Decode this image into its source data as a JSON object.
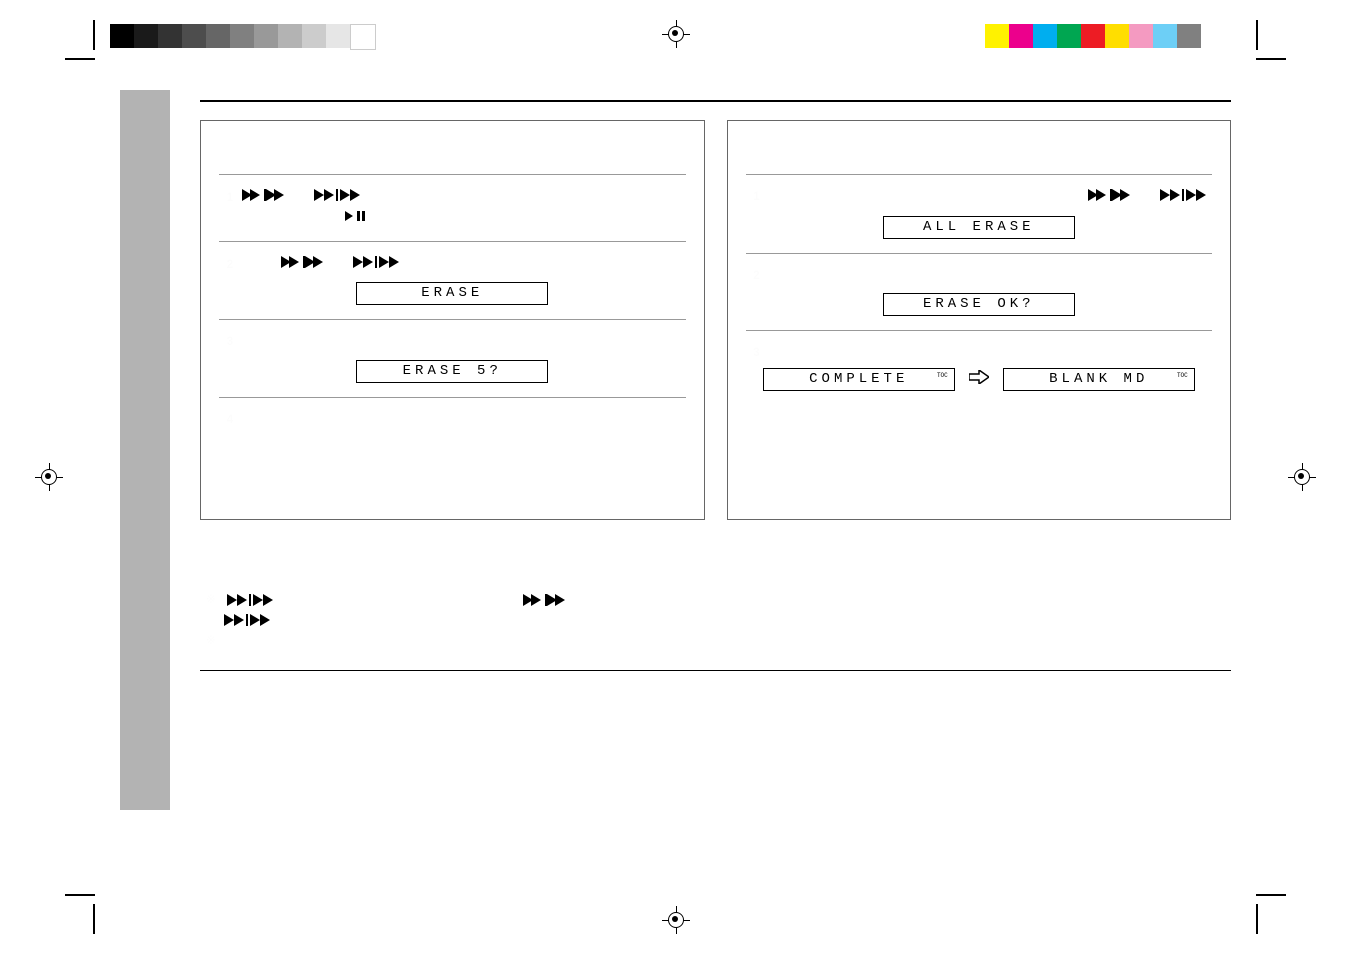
{
  "displays": {
    "erase": "ERASE",
    "erase_q": "ERASE  5?",
    "all_erase": "ALL ERASE",
    "erase_ok": "ERASE OK?",
    "complete": "COMPLETE",
    "blank_md": "BLANK MD"
  },
  "toc_tag": "TOC",
  "gray_swatches": [
    "#000000",
    "#1a1a1a",
    "#333333",
    "#4d4d4d",
    "#666666",
    "#808080",
    "#999999",
    "#b3b3b3",
    "#cccccc",
    "#e6e6e6",
    "#ffffff"
  ],
  "color_swatches": [
    "#fff200",
    "#ec008c",
    "#00aeef",
    "#00a651",
    "#ed1c24",
    "#ffde00",
    "#f49ac1",
    "#6dcff6",
    "#808080"
  ]
}
